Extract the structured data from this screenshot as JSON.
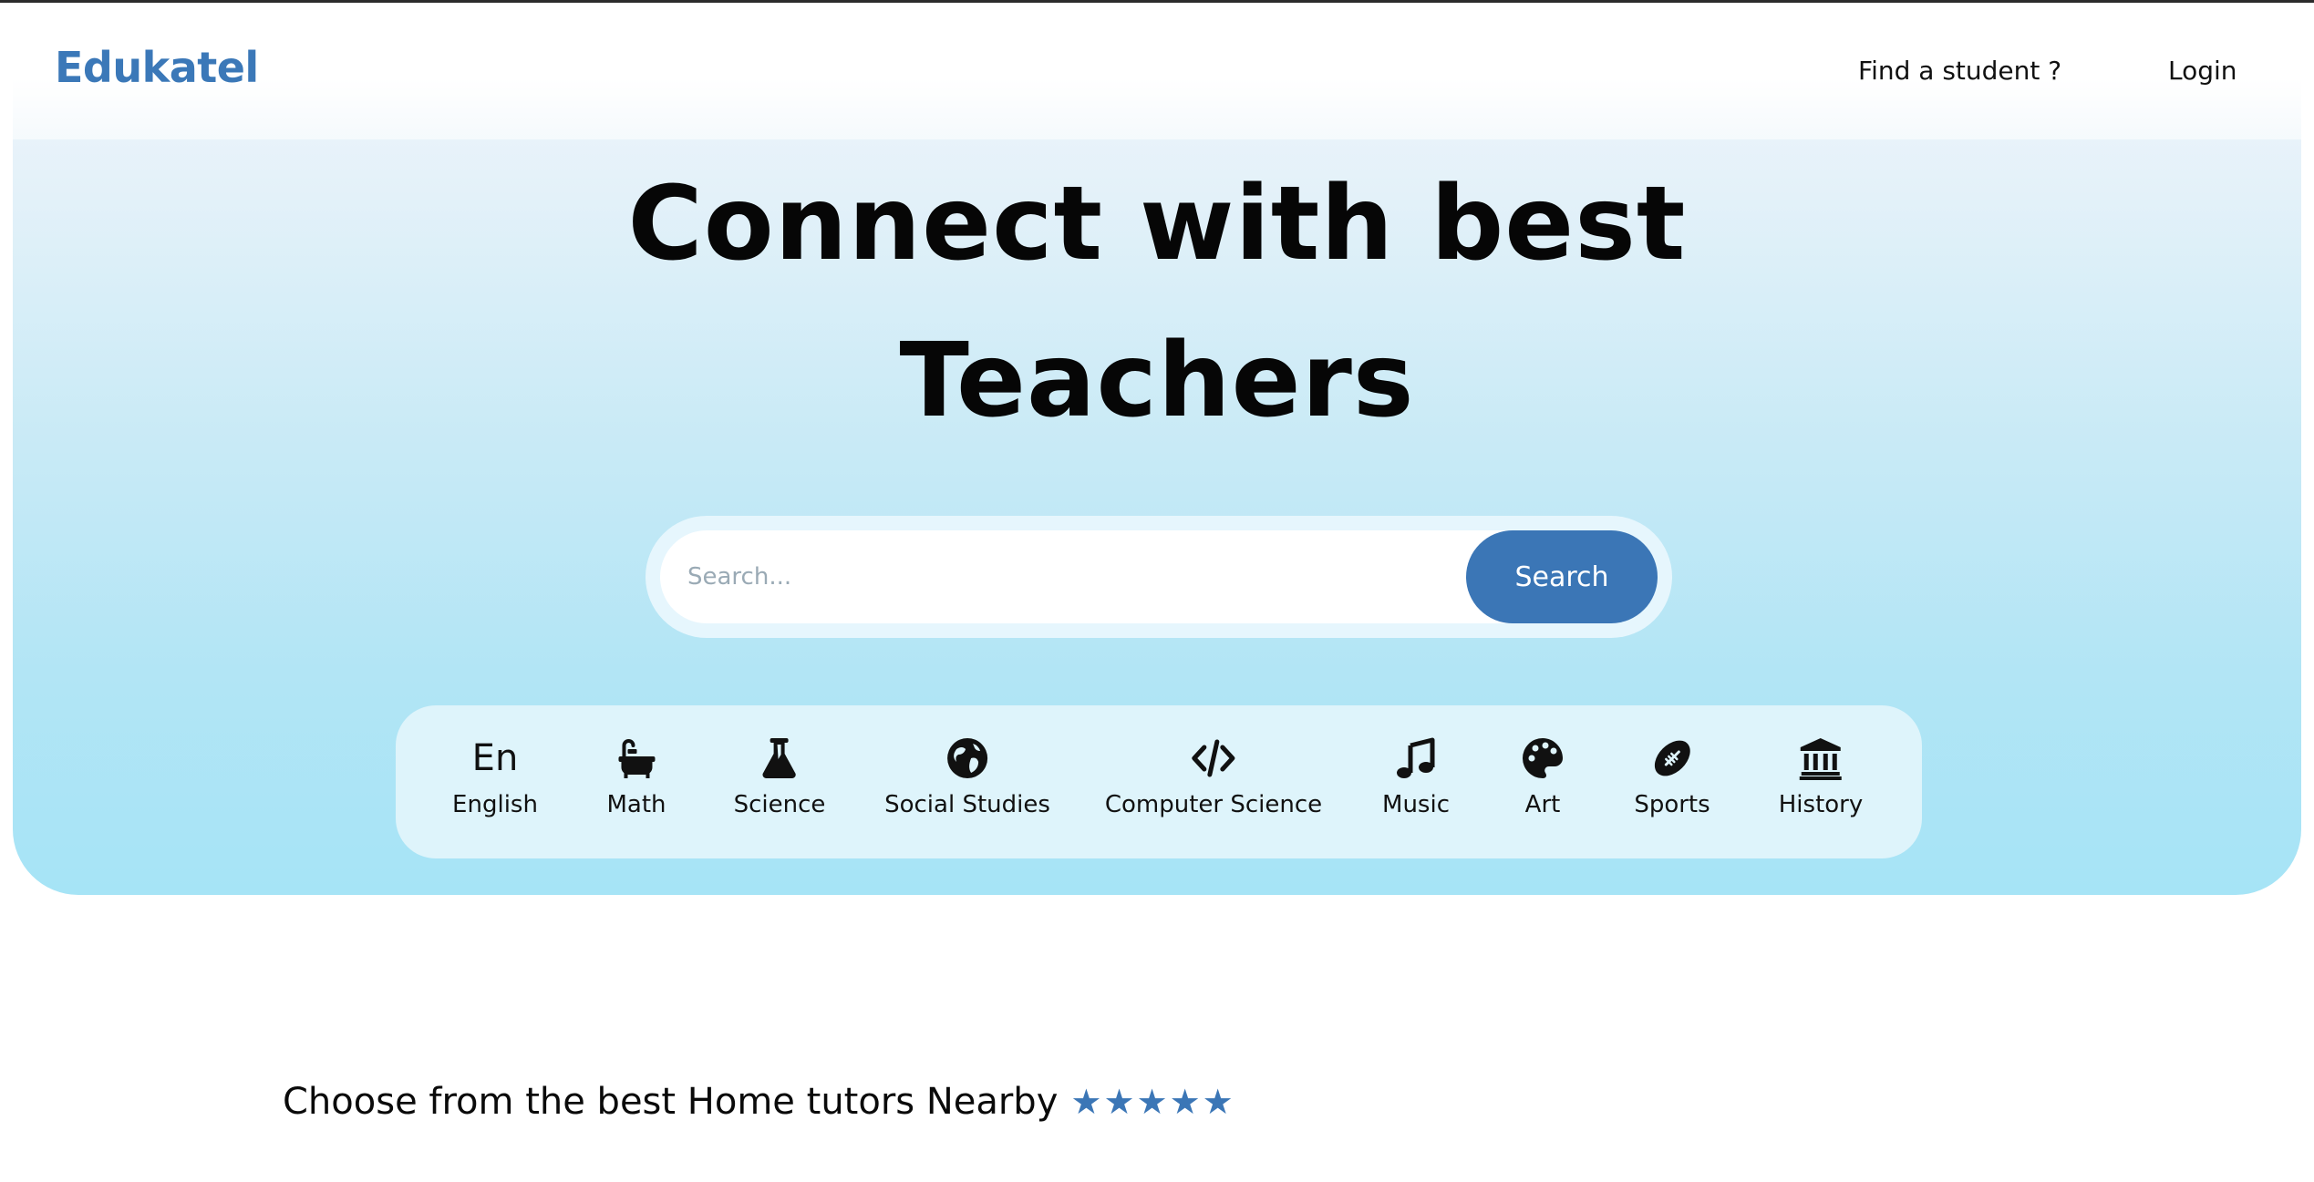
{
  "navbar": {
    "logo": "Edukatel",
    "links": [
      {
        "label": "Find a student ?"
      },
      {
        "label": "Login"
      }
    ]
  },
  "hero": {
    "headline_line1": "Connect with best",
    "headline_line2": "Teachers"
  },
  "search": {
    "placeholder": "Search...",
    "button_label": "Search"
  },
  "categories": [
    {
      "label": "English",
      "icon": "en-icon"
    },
    {
      "label": "Math",
      "icon": "bathtub-icon"
    },
    {
      "label": "Science",
      "icon": "flask-icon"
    },
    {
      "label": "Social Studies",
      "icon": "globe-icon"
    },
    {
      "label": "Computer Science",
      "icon": "code-icon"
    },
    {
      "label": "Music",
      "icon": "music-note-icon"
    },
    {
      "label": "Art",
      "icon": "palette-icon"
    },
    {
      "label": "Sports",
      "icon": "football-icon"
    },
    {
      "label": "History",
      "icon": "museum-icon"
    }
  ],
  "tagline": {
    "text": "Choose from the best Home tutors Nearby",
    "stars": "★★★★★"
  },
  "colors": {
    "brand": "#3b78b8",
    "button": "#3b76b6",
    "hero_bottom": "#a6e4f6"
  }
}
